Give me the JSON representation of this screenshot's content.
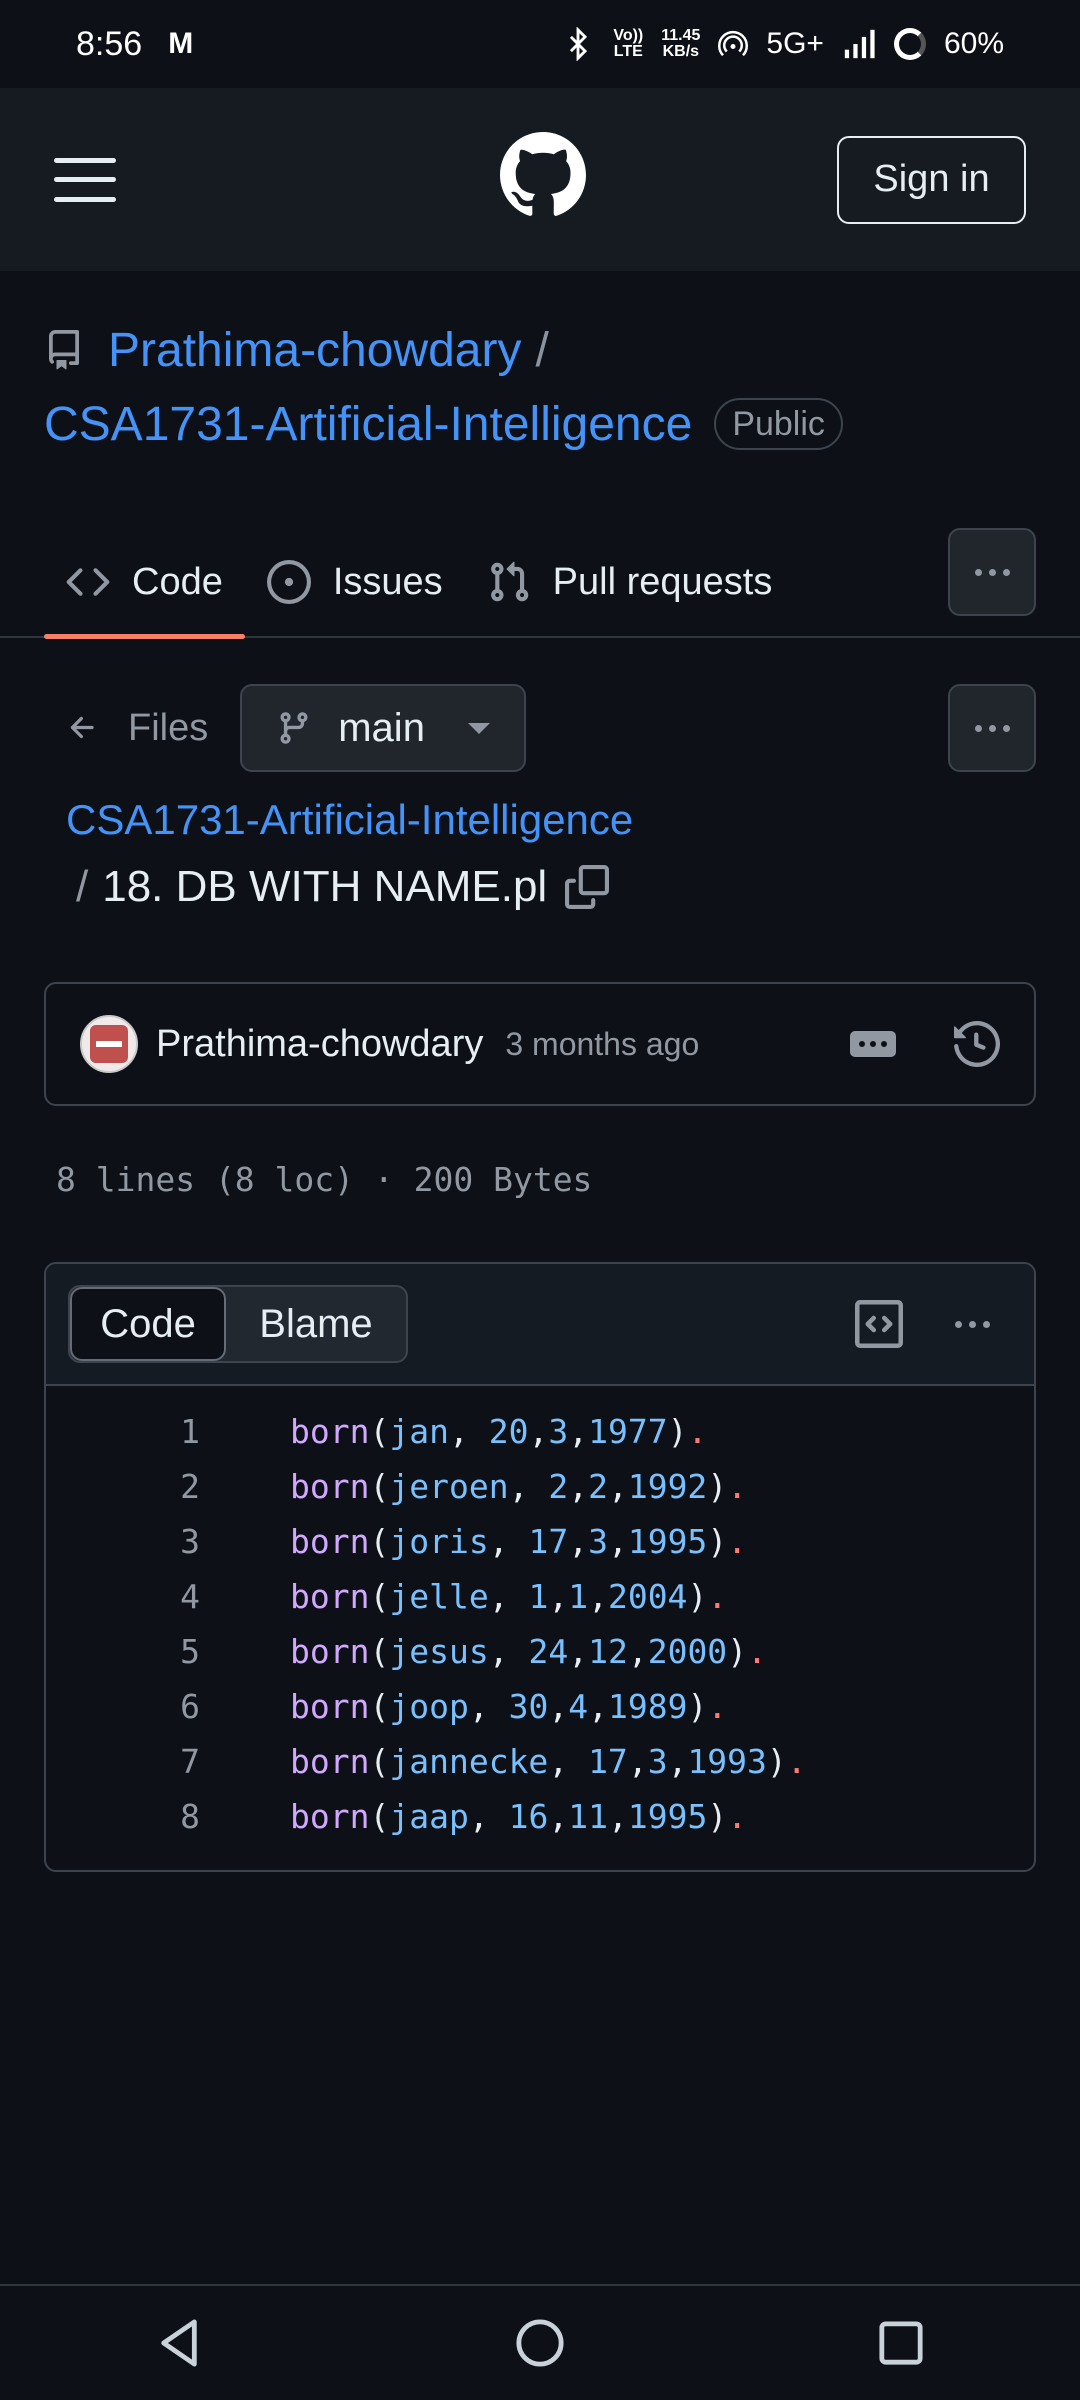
{
  "status_bar": {
    "time": "8:56",
    "carrier_icon": "M",
    "network_speed_top": "11.45",
    "network_speed_bottom": "KB/s",
    "volte_top": "Vo))",
    "volte_bottom": "LTE",
    "network": "5G+",
    "battery": "60%"
  },
  "header": {
    "menu_icon": "hamburger-icon",
    "logo_icon": "github-logo-icon",
    "signin_label": "Sign in"
  },
  "repo": {
    "owner": "Prathima-chowdary",
    "separator": "/",
    "name": "CSA1731-Artificial-Intelligence",
    "visibility": "Public"
  },
  "tabs": [
    {
      "label": "Code",
      "icon": "code-icon",
      "active": true
    },
    {
      "label": "Issues",
      "icon": "issue-opened-icon",
      "active": false
    },
    {
      "label": "Pull requests",
      "icon": "git-pull-request-icon",
      "active": false
    }
  ],
  "files_bar": {
    "files_label": "Files",
    "branch": "main"
  },
  "breadcrumb": {
    "repo": "CSA1731-Artificial-Intelligence",
    "separator": "/",
    "file": "18. DB WITH NAME.pl"
  },
  "commit": {
    "author": "Prathima-chowdary",
    "time": "3 months ago"
  },
  "file_meta": "8 lines (8 loc) · 200 Bytes",
  "code_view": {
    "code_label": "Code",
    "blame_label": "Blame",
    "lines": [
      {
        "n": "1",
        "name": "jan",
        "sep": ", ",
        "d": "20",
        "m": "3",
        "y": "1977"
      },
      {
        "n": "2",
        "name": "jeroen",
        "sep": ", ",
        "d": "2",
        "m": "2",
        "y": "1992"
      },
      {
        "n": "3",
        "name": "joris",
        "sep": ", ",
        "d": "17",
        "m": "3",
        "y": "1995"
      },
      {
        "n": "4",
        "name": "jelle",
        "sep": ", ",
        "d": "1",
        "m": "1",
        "y": "2004"
      },
      {
        "n": "5",
        "name": "jesus",
        "sep": ", ",
        "d": "24",
        "m": "12",
        "y": "2000"
      },
      {
        "n": "6",
        "name": "joop",
        "sep": ", ",
        "d": "30",
        "m": "4",
        "y": "1989"
      },
      {
        "n": "7",
        "name": "jannecke",
        "sep": ", ",
        "d": "17",
        "m": "3",
        "y": "1993"
      },
      {
        "n": "8",
        "name": "jaap",
        "sep": ", ",
        "d": "16",
        "m": "11",
        "y": "1995"
      }
    ],
    "keyword": "born"
  },
  "colors": {
    "background": "#0d1117",
    "link": "#4493f8",
    "tab_underline": "#f78166",
    "keyword": "#d2a8ff",
    "atom": "#79c0ff",
    "period": "#ff7b72"
  }
}
